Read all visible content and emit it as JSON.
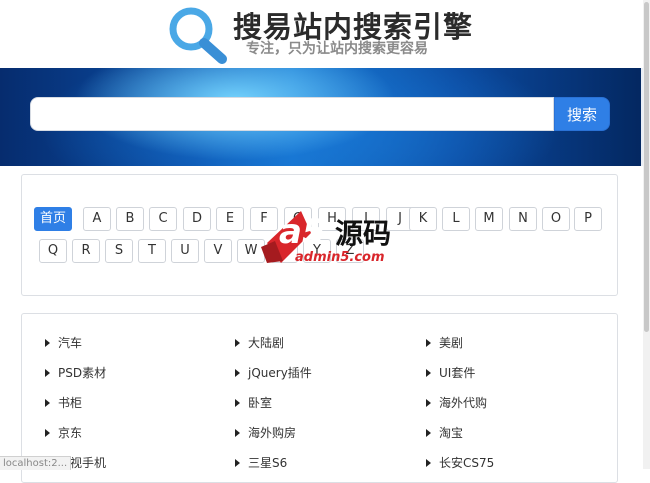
{
  "header": {
    "title": "搜易站内搜索引擎",
    "slogan": "专注，只为让站内搜索更容易"
  },
  "search": {
    "placeholder": "",
    "value": "",
    "button_label": "搜索"
  },
  "letters": [
    "首页",
    "A",
    "B",
    "C",
    "D",
    "E",
    "F",
    "G",
    "H",
    "I",
    "J",
    "K",
    "L",
    "M",
    "N",
    "O",
    "P",
    "Q",
    "R",
    "S",
    "T",
    "U",
    "V",
    "W",
    "X",
    "Y",
    "Z"
  ],
  "watermark": {
    "main": "a5",
    "cn": "源码",
    "url": "admin5.com"
  },
  "categories": [
    [
      "汽车",
      "大陆剧",
      "美剧"
    ],
    [
      "PSD素材",
      "jQuery插件",
      "UI套件"
    ],
    [
      "书柜",
      "卧室",
      "海外代购"
    ],
    [
      "京东",
      "海外购房",
      "淘宝"
    ],
    [
      "乐视手机",
      "三星S6",
      "长安CS75"
    ]
  ],
  "status": {
    "text": "localhost:2..."
  },
  "colors": {
    "accent": "#2f7fe6",
    "banner_dark": "#062c6e",
    "banner_light": "#48b8f2"
  }
}
